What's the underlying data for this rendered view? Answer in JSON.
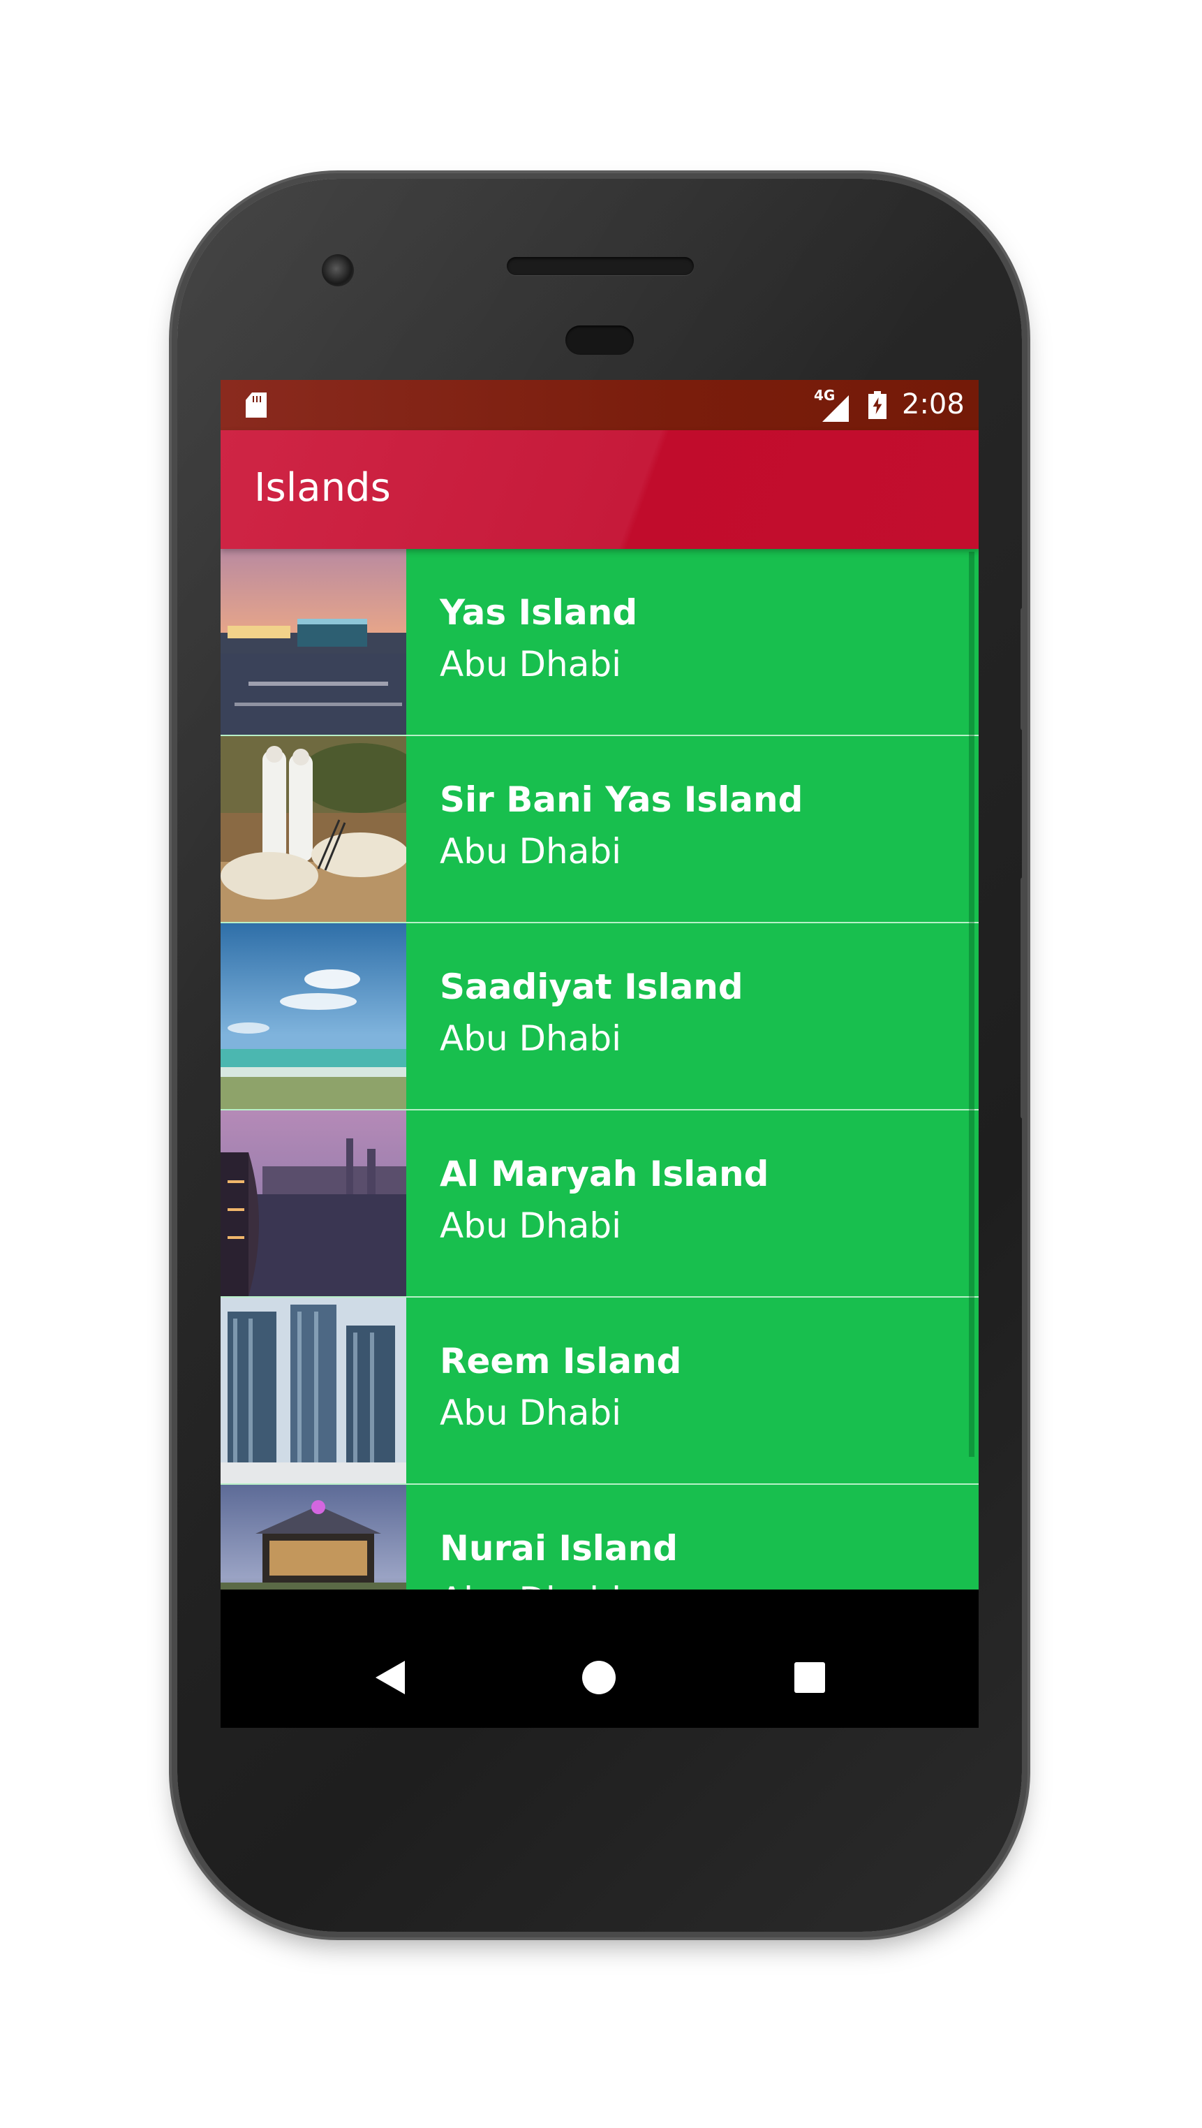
{
  "status_bar": {
    "network": "4G",
    "time": "2:08"
  },
  "app_bar": {
    "title": "Islands"
  },
  "islands": [
    {
      "name": "Yas Island",
      "city": "Abu Dhabi"
    },
    {
      "name": "Sir Bani Yas Island",
      "city": "Abu Dhabi"
    },
    {
      "name": "Saadiyat Island",
      "city": "Abu Dhabi"
    },
    {
      "name": "Al Maryah Island",
      "city": "Abu Dhabi"
    },
    {
      "name": "Reem Island",
      "city": "Abu Dhabi"
    },
    {
      "name": "Nurai Island",
      "city": "Abu Dhabi"
    }
  ],
  "navigation": {
    "icons": [
      "back-icon",
      "home-icon",
      "recents-icon"
    ]
  },
  "colors": {
    "status_bar": "#7a1d0c",
    "app_bar": "#c61a3a",
    "list_background": "#18bf4e",
    "row_divider": "#b8f0c8"
  }
}
